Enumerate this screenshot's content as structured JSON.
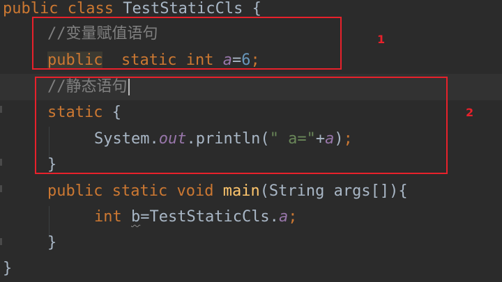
{
  "editor": {
    "lines": [
      {
        "tokens": [
          {
            "t": "public",
            "c": "kw"
          },
          {
            "t": " "
          },
          {
            "t": "class",
            "c": "kw"
          },
          {
            "t": " TestStaticCls {"
          }
        ]
      },
      {
        "tokens": [
          {
            "t": "//变量赋值语句",
            "c": "cm"
          }
        ]
      },
      {
        "tokens": [
          {
            "t": "public",
            "c": "kw hl-kw"
          },
          {
            "t": "  "
          },
          {
            "t": "static",
            "c": "kw"
          },
          {
            "t": " "
          },
          {
            "t": "int",
            "c": "kw"
          },
          {
            "t": " "
          },
          {
            "t": "a",
            "c": "fld"
          },
          {
            "t": "="
          },
          {
            "t": "6",
            "c": "num"
          },
          {
            "t": ";",
            "c": "kw"
          }
        ]
      },
      {
        "tokens": [
          {
            "t": "//静态语句",
            "c": "cm"
          }
        ]
      },
      {
        "tokens": [
          {
            "t": "static",
            "c": "kw"
          },
          {
            "t": " {"
          }
        ]
      },
      {
        "tokens": [
          {
            "t": "System."
          },
          {
            "t": "out",
            "c": "fld"
          },
          {
            "t": ".println("
          },
          {
            "t": "\" a=\"",
            "c": "str"
          },
          {
            "t": "+"
          },
          {
            "t": "a",
            "c": "fld"
          },
          {
            "t": ")"
          },
          {
            "t": ";",
            "c": "kw"
          }
        ]
      },
      {
        "tokens": [
          {
            "t": "}"
          }
        ]
      },
      {
        "tokens": [
          {
            "t": "public",
            "c": "kw"
          },
          {
            "t": " "
          },
          {
            "t": "static",
            "c": "kw"
          },
          {
            "t": " "
          },
          {
            "t": "void",
            "c": "kw"
          },
          {
            "t": " "
          },
          {
            "t": "main",
            "c": "fn"
          },
          {
            "t": "(String args[]){"
          }
        ]
      },
      {
        "tokens": [
          {
            "t": "int",
            "c": "kw"
          },
          {
            "t": " "
          },
          {
            "t": "b",
            "c": "squig"
          },
          {
            "t": "=TestStaticCls."
          },
          {
            "t": "a",
            "c": "fld"
          },
          {
            "t": ";",
            "c": "kw"
          }
        ]
      },
      {
        "tokens": [
          {
            "t": "}"
          }
        ]
      },
      {
        "tokens": [
          {
            "t": "}"
          }
        ]
      }
    ]
  },
  "annotations": {
    "box1_label": "1",
    "box2_label": "2",
    "color": "#e8212b"
  }
}
